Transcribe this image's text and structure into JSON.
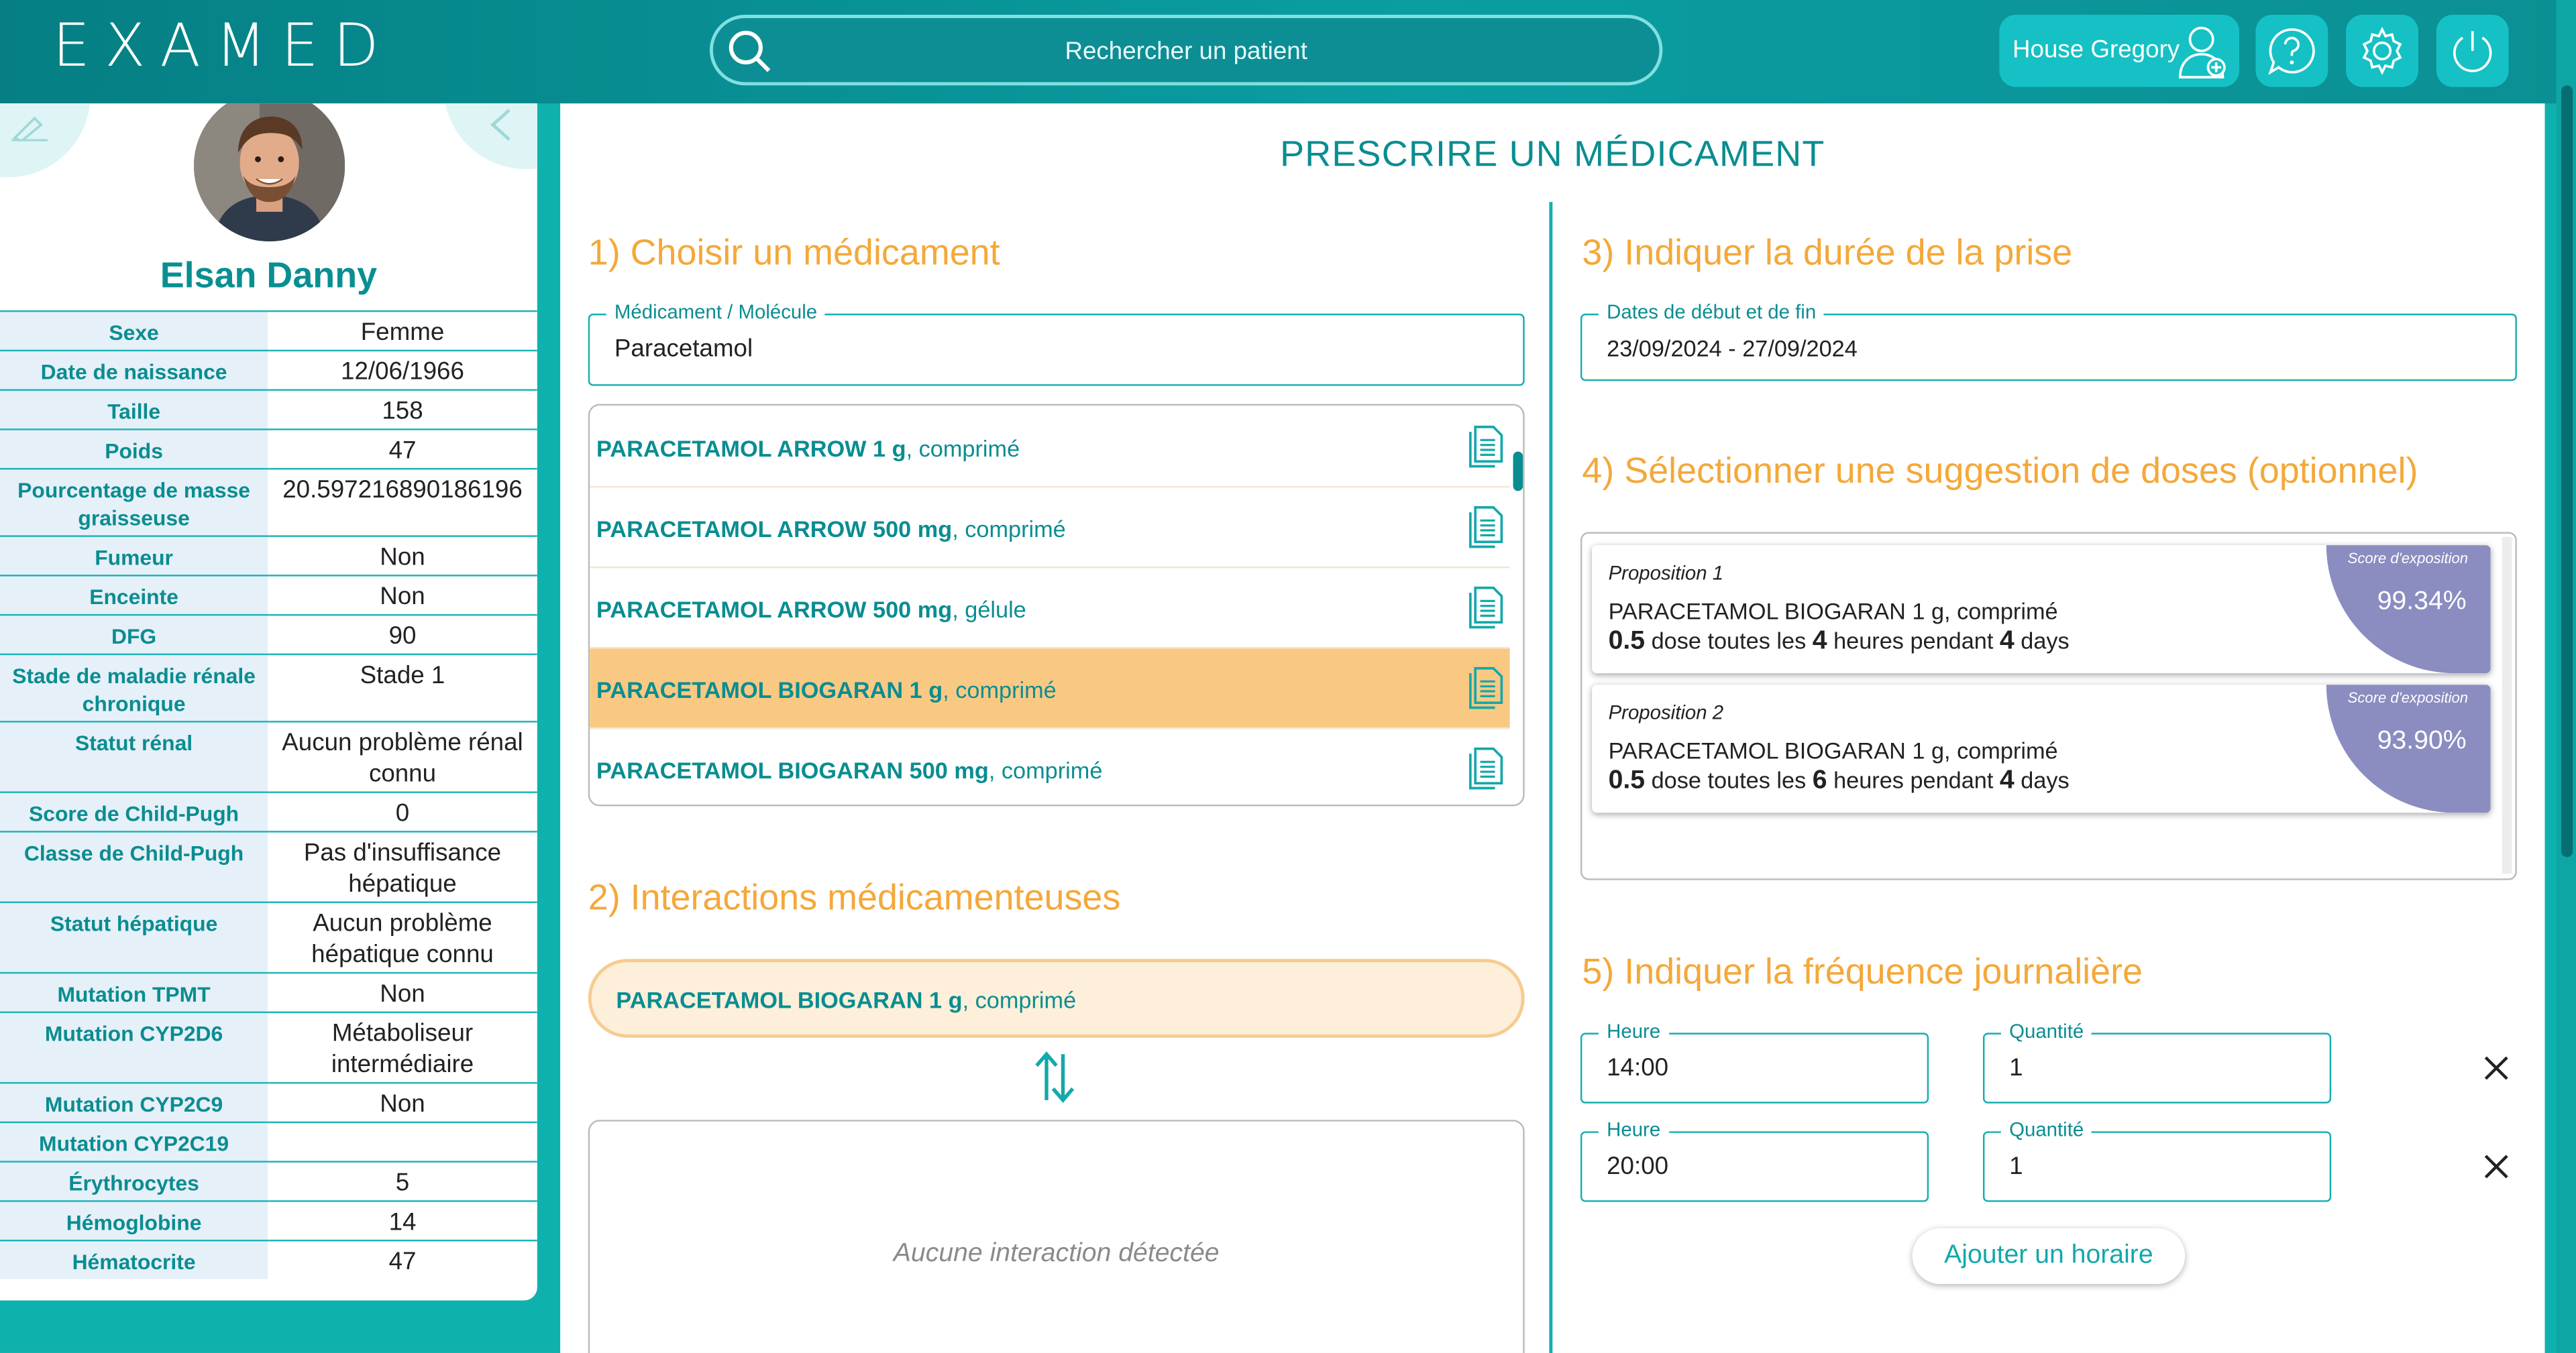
{
  "header": {
    "logo": "EXAMED",
    "search_placeholder": "Rechercher un patient",
    "user_name": "House Gregory"
  },
  "patient": {
    "name": "Elsan Danny",
    "attributes": [
      {
        "label": "Sexe",
        "value": "Femme"
      },
      {
        "label": "Date de naissance",
        "value": "12/06/1966"
      },
      {
        "label": "Taille",
        "value": "158"
      },
      {
        "label": "Poids",
        "value": "47"
      },
      {
        "label": "Pourcentage de masse graisseuse",
        "value": "20.597216890186196"
      },
      {
        "label": "Fumeur",
        "value": "Non"
      },
      {
        "label": "Enceinte",
        "value": "Non"
      },
      {
        "label": "DFG",
        "value": "90"
      },
      {
        "label": "Stade de maladie rénale chronique",
        "value": "Stade 1"
      },
      {
        "label": "Statut rénal",
        "value": "Aucun problème rénal connu"
      },
      {
        "label": "Score de Child-Pugh",
        "value": "0"
      },
      {
        "label": "Classe de Child-Pugh",
        "value": "Pas d'insuffisance hépatique"
      },
      {
        "label": "Statut hépatique",
        "value": "Aucun problème hépatique connu"
      },
      {
        "label": "Mutation TPMT",
        "value": "Non"
      },
      {
        "label": "Mutation CYP2D6",
        "value": "Métaboliseur intermédiaire"
      },
      {
        "label": "Mutation CYP2C9",
        "value": "Non"
      },
      {
        "label": "Mutation CYP2C19",
        "value": ""
      },
      {
        "label": "Érythrocytes",
        "value": "5"
      },
      {
        "label": "Hémoglobine",
        "value": "14"
      },
      {
        "label": "Hématocrite",
        "value": "47"
      }
    ]
  },
  "main": {
    "title": "PRESCRIRE UN MÉDICAMENT",
    "step1": {
      "title": "1) Choisir un médicament",
      "field_label": "Médicament / Molécule",
      "field_value": "Paracetamol",
      "results": [
        {
          "name": "PARACETAMOL ARROW 1 g",
          "form": ", comprimé",
          "selected": false
        },
        {
          "name": "PARACETAMOL ARROW 500 mg",
          "form": ", comprimé",
          "selected": false
        },
        {
          "name": "PARACETAMOL ARROW 500 mg",
          "form": ", gélule",
          "selected": false
        },
        {
          "name": "PARACETAMOL BIOGARAN 1 g",
          "form": ", comprimé",
          "selected": true
        },
        {
          "name": "PARACETAMOL BIOGARAN 500 mg",
          "form": ", comprimé",
          "selected": false
        }
      ]
    },
    "step2": {
      "title": "2) Interactions médicamenteuses",
      "selected_name": "PARACETAMOL BIOGARAN 1 g",
      "selected_form": ", comprimé",
      "empty_text": "Aucune interaction détectée"
    },
    "step3": {
      "title": "3) Indiquer la durée de la prise",
      "field_label": "Dates de début et de fin",
      "field_value": "23/09/2024  -  27/09/2024"
    },
    "step4": {
      "title": "4) Sélectionner une suggestion de doses (optionnel)",
      "proposals": [
        {
          "label": "Proposition 1",
          "drug": "PARACETAMOL BIOGARAN 1 g, comprimé",
          "dose": "0.5",
          "t1": " dose toutes les ",
          "interval": "4",
          "t2": " heures pendant ",
          "duration": "4",
          "t3": " days",
          "score_label": "Score d'exposition",
          "score": "99.34%"
        },
        {
          "label": "Proposition 2",
          "drug": "PARACETAMOL BIOGARAN 1 g, comprimé",
          "dose": "0.5",
          "t1": " dose toutes les ",
          "interval": "6",
          "t2": " heures pendant ",
          "duration": "4",
          "t3": " days",
          "score_label": "Score d'exposition",
          "score": "93.90%"
        }
      ]
    },
    "step5": {
      "title": "5) Indiquer la fréquence journalière",
      "rows": [
        {
          "hour_label": "Heure",
          "hour": "14:00",
          "qty_label": "Quantité",
          "qty": "1"
        },
        {
          "hour_label": "Heure",
          "hour": "20:00",
          "qty_label": "Quantité",
          "qty": "1"
        }
      ],
      "add_label": "Ajouter un horaire"
    }
  },
  "colors": {
    "teal": "#0a8d91",
    "orange": "#f4a83a",
    "score": "#8b8dc1",
    "selected": "#f9c983"
  }
}
